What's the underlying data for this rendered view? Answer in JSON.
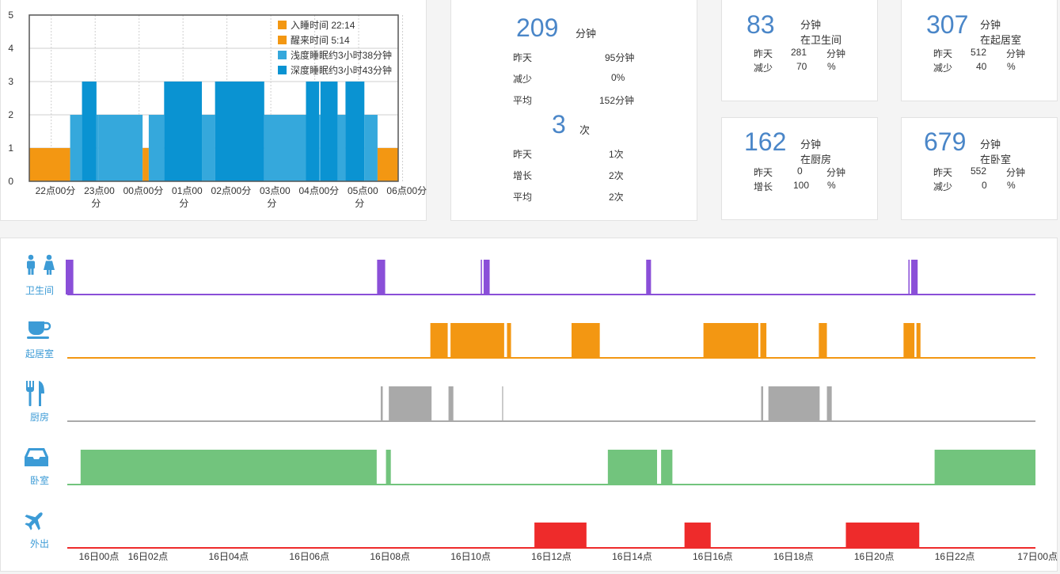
{
  "sleep_chart": {
    "chart_data": {
      "type": "bar",
      "ylim": [
        0,
        5
      ],
      "yticks": [
        "0",
        "1",
        "2",
        "3",
        "4",
        "5"
      ],
      "xticks": [
        {
          "line1": "22点00分",
          "line2": ""
        },
        {
          "line1": "23点00",
          "line2": "分"
        },
        {
          "line1": "00点00分",
          "line2": ""
        },
        {
          "line1": "01点00",
          "line2": "分"
        },
        {
          "line1": "02点00分",
          "line2": ""
        },
        {
          "line1": "03点00",
          "line2": "分"
        },
        {
          "line1": "04点00分",
          "line2": ""
        },
        {
          "line1": "05点00",
          "line2": "分"
        },
        {
          "line1": "06点00分",
          "line2": ""
        }
      ],
      "x_range_hours": [
        22,
        30.4
      ],
      "levels": {
        "awake": 1,
        "light": 2,
        "deep": 3
      },
      "legend": [
        {
          "label": "入睡时间 22:14",
          "color": "#f39712"
        },
        {
          "label": "醒来时间 5:14",
          "color": "#f39712"
        },
        {
          "label": "浅度睡眠约3小时38分钟",
          "color": "#35a8dc"
        },
        {
          "label": "深度睡眠约3小时43分钟",
          "color": "#0a93d2"
        }
      ],
      "segments": [
        {
          "start": 22.0,
          "end": 22.93,
          "level": 1,
          "kind": "awake"
        },
        {
          "start": 22.93,
          "end": 23.2,
          "level": 2,
          "kind": "light"
        },
        {
          "start": 23.2,
          "end": 23.53,
          "level": 3,
          "kind": "deep"
        },
        {
          "start": 23.53,
          "end": 23.57,
          "level": 2,
          "kind": "light"
        },
        {
          "start": 23.57,
          "end": 24.58,
          "level": 2,
          "kind": "light"
        },
        {
          "start": 24.58,
          "end": 24.72,
          "level": 1,
          "kind": "awake"
        },
        {
          "start": 24.72,
          "end": 25.07,
          "level": 2,
          "kind": "light"
        },
        {
          "start": 25.07,
          "end": 25.93,
          "level": 3,
          "kind": "deep"
        },
        {
          "start": 25.93,
          "end": 26.23,
          "level": 2,
          "kind": "light"
        },
        {
          "start": 26.23,
          "end": 27.35,
          "level": 3,
          "kind": "deep"
        },
        {
          "start": 27.35,
          "end": 28.3,
          "level": 2,
          "kind": "light"
        },
        {
          "start": 28.3,
          "end": 28.6,
          "level": 3,
          "kind": "deep"
        },
        {
          "start": 28.6,
          "end": 28.63,
          "level": 2,
          "kind": "light"
        },
        {
          "start": 28.63,
          "end": 29.02,
          "level": 3,
          "kind": "deep"
        },
        {
          "start": 29.02,
          "end": 29.2,
          "level": 2,
          "kind": "light"
        },
        {
          "start": 29.2,
          "end": 29.63,
          "level": 3,
          "kind": "deep"
        },
        {
          "start": 29.63,
          "end": 29.93,
          "level": 2,
          "kind": "light"
        },
        {
          "start": 29.93,
          "end": 30.4,
          "level": 1,
          "kind": "awake"
        }
      ]
    }
  },
  "summary": {
    "sleep": {
      "value": "209",
      "unit": "分钟",
      "rows": [
        {
          "label": "昨天",
          "value": "95分钟"
        },
        {
          "label": "减少",
          "value": "0%"
        },
        {
          "label": "平均",
          "value": "152分钟"
        }
      ]
    },
    "count": {
      "value": "3",
      "unit": "次",
      "rows": [
        {
          "label": "昨天",
          "value": "1次"
        },
        {
          "label": "增长",
          "value": "2次"
        },
        {
          "label": "平均",
          "value": "2次"
        }
      ]
    }
  },
  "room_cards": [
    {
      "value": "83",
      "unit": "分钟",
      "place": "在卫生间",
      "yesterday_label": "昨天",
      "yesterday_value": "281",
      "yesterday_unit": "分钟",
      "change_label": "减少",
      "change_value": "70",
      "change_unit": "%"
    },
    {
      "value": "307",
      "unit": "分钟",
      "place": "在起居室",
      "yesterday_label": "昨天",
      "yesterday_value": "512",
      "yesterday_unit": "分钟",
      "change_label": "减少",
      "change_value": "40",
      "change_unit": "%"
    },
    {
      "value": "162",
      "unit": "分钟",
      "place": "在厨房",
      "yesterday_label": "昨天",
      "yesterday_value": "0",
      "yesterday_unit": "分钟",
      "change_label": "增长",
      "change_value": "100",
      "change_unit": "%"
    },
    {
      "value": "679",
      "unit": "分钟",
      "place": "在卧室",
      "yesterday_label": "昨天",
      "yesterday_value": "552",
      "yesterday_unit": "分钟",
      "change_label": "减少",
      "change_value": "0",
      "change_unit": "%"
    }
  ],
  "timeline": {
    "x_range_hours": [
      0,
      24
    ],
    "x_ticks": [
      "16日00点",
      "16日02点",
      "16日04点",
      "16日06点",
      "16日08点",
      "16日10点",
      "16日12点",
      "16日14点",
      "16日16点",
      "16日18点",
      "16日20点",
      "16日22点",
      "17日00点"
    ],
    "rows": [
      {
        "key": "bathroom",
        "label": "卫生间",
        "icon": "restroom-icon",
        "color": "#8a4fd8",
        "events": [
          [
            -0.07,
            0.15
          ],
          [
            7.68,
            7.88
          ],
          [
            10.25,
            10.28
          ],
          [
            10.32,
            10.47
          ],
          [
            14.35,
            14.47
          ],
          [
            20.85,
            20.88
          ],
          [
            20.92,
            21.08
          ]
        ]
      },
      {
        "key": "living",
        "label": "起居室",
        "icon": "coffee-cup-icon",
        "color": "#f39712",
        "events": [
          [
            9.0,
            9.43
          ],
          [
            9.5,
            10.83
          ],
          [
            10.9,
            11.0
          ],
          [
            12.5,
            13.2
          ],
          [
            15.77,
            17.13
          ],
          [
            17.18,
            17.33
          ],
          [
            18.63,
            18.83
          ],
          [
            20.73,
            21.0
          ],
          [
            21.05,
            21.15
          ]
        ]
      },
      {
        "key": "kitchen",
        "label": "厨房",
        "icon": "fork-knife-icon",
        "color": "#a9a9a9",
        "events": [
          [
            7.77,
            7.82
          ],
          [
            7.97,
            9.03
          ],
          [
            9.45,
            9.57
          ],
          [
            10.78,
            10.8
          ],
          [
            17.2,
            17.25
          ],
          [
            17.38,
            18.65
          ],
          [
            18.83,
            18.95
          ]
        ]
      },
      {
        "key": "bedroom",
        "label": "卧室",
        "icon": "inbox-tray-icon",
        "color": "#72c47d",
        "events": [
          [
            0.33,
            7.67
          ],
          [
            7.9,
            8.02
          ],
          [
            13.4,
            14.62
          ],
          [
            14.72,
            15.0
          ],
          [
            21.5,
            24.0
          ]
        ]
      },
      {
        "key": "outside",
        "label": "外出",
        "icon": "airplane-icon",
        "color": "#ee2b2b",
        "events": [
          [
            11.58,
            12.87
          ],
          [
            15.3,
            15.95
          ],
          [
            19.3,
            21.12
          ]
        ]
      }
    ]
  }
}
